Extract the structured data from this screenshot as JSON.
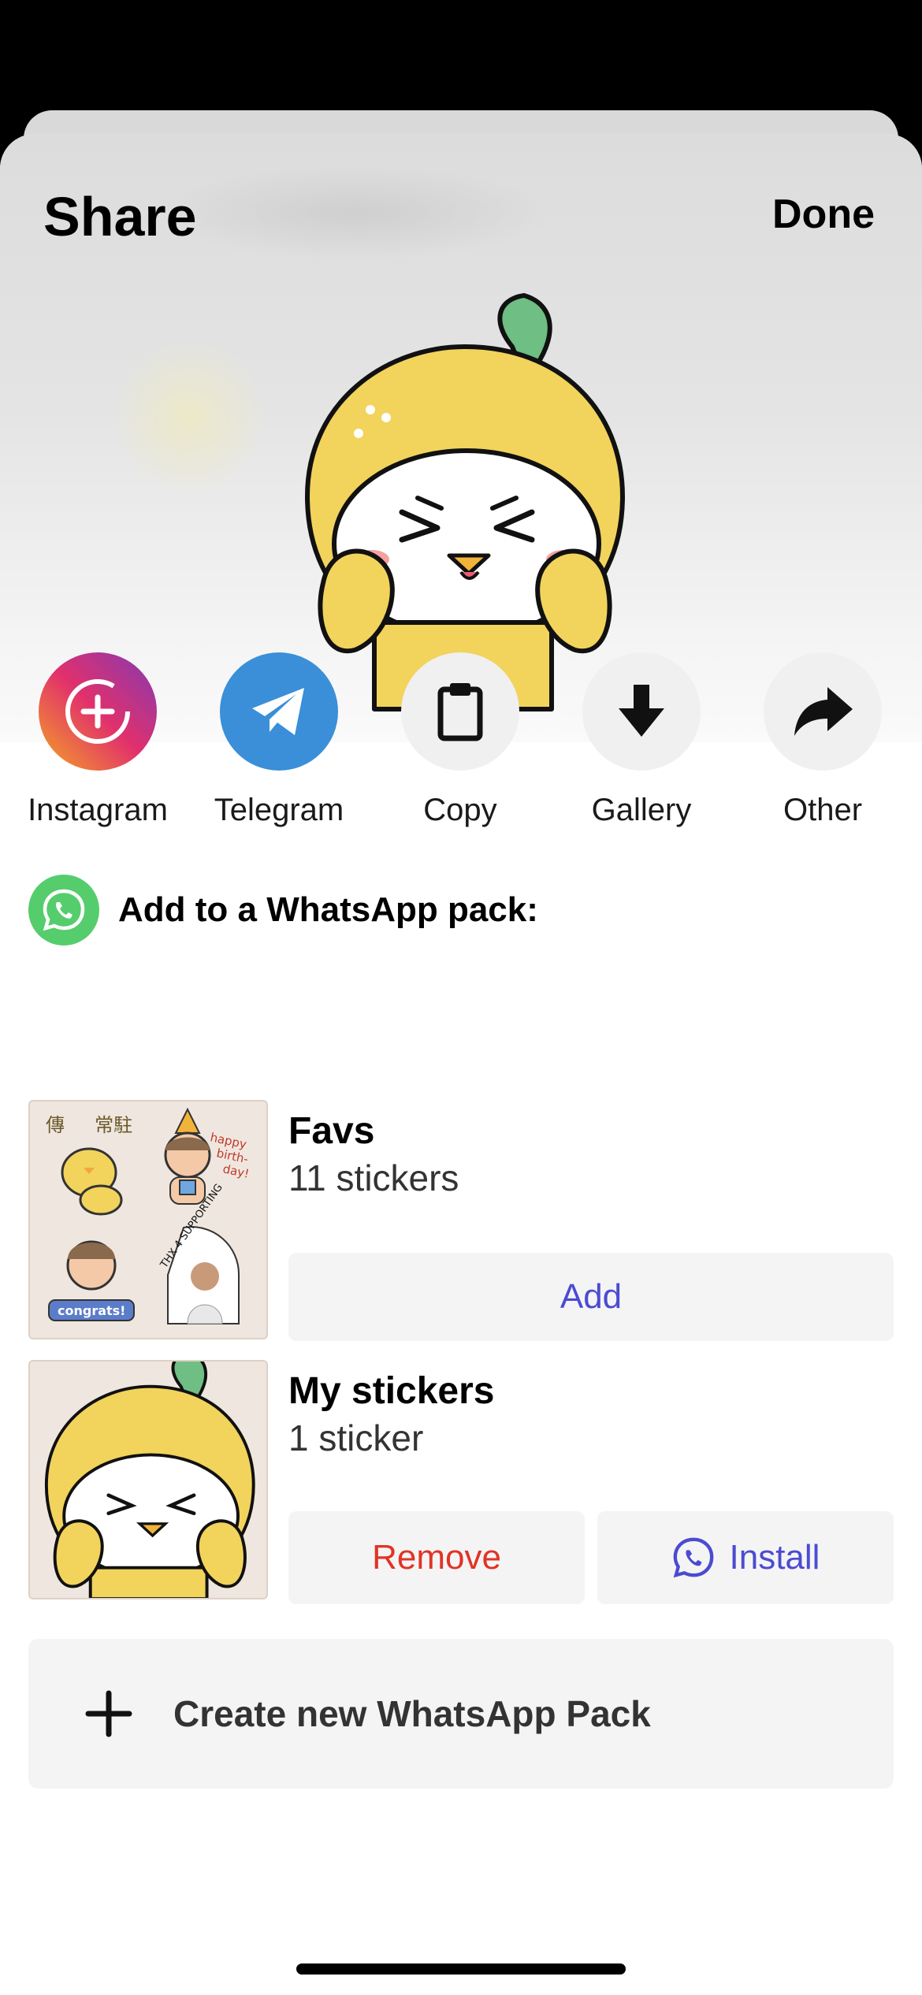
{
  "header": {
    "title": "Share",
    "done_label": "Done"
  },
  "share_targets": [
    {
      "label": "Instagram",
      "icon": "instagram-icon"
    },
    {
      "label": "Telegram",
      "icon": "telegram-icon"
    },
    {
      "label": "Copy",
      "icon": "clipboard-icon"
    },
    {
      "label": "Gallery",
      "icon": "download-arrow-icon"
    },
    {
      "label": "Other",
      "icon": "share-arrow-icon"
    }
  ],
  "whatsapp": {
    "heading": "Add to a WhatsApp pack:",
    "packs": [
      {
        "name": "Favs",
        "count": "11 stickers",
        "action": "Add"
      },
      {
        "name": "My stickers",
        "count": "1 sticker",
        "remove_label": "Remove",
        "install_label": "Install"
      }
    ],
    "create_label": "Create new WhatsApp Pack"
  },
  "sticker_texts": {
    "chinese": "傳     常駐",
    "happy": "happy",
    "birth": "birth-",
    "day": "day!",
    "congrats": "congrats!",
    "thx": "THX 4 SUPPORTING"
  },
  "colors": {
    "telegram": "#3a8fd8",
    "whatsapp": "#55cd6c",
    "action_blue": "#4b4bd2",
    "remove_red": "#e03426",
    "sticker_yellow": "#f2d35c",
    "leaf_green": "#6fbe84"
  }
}
